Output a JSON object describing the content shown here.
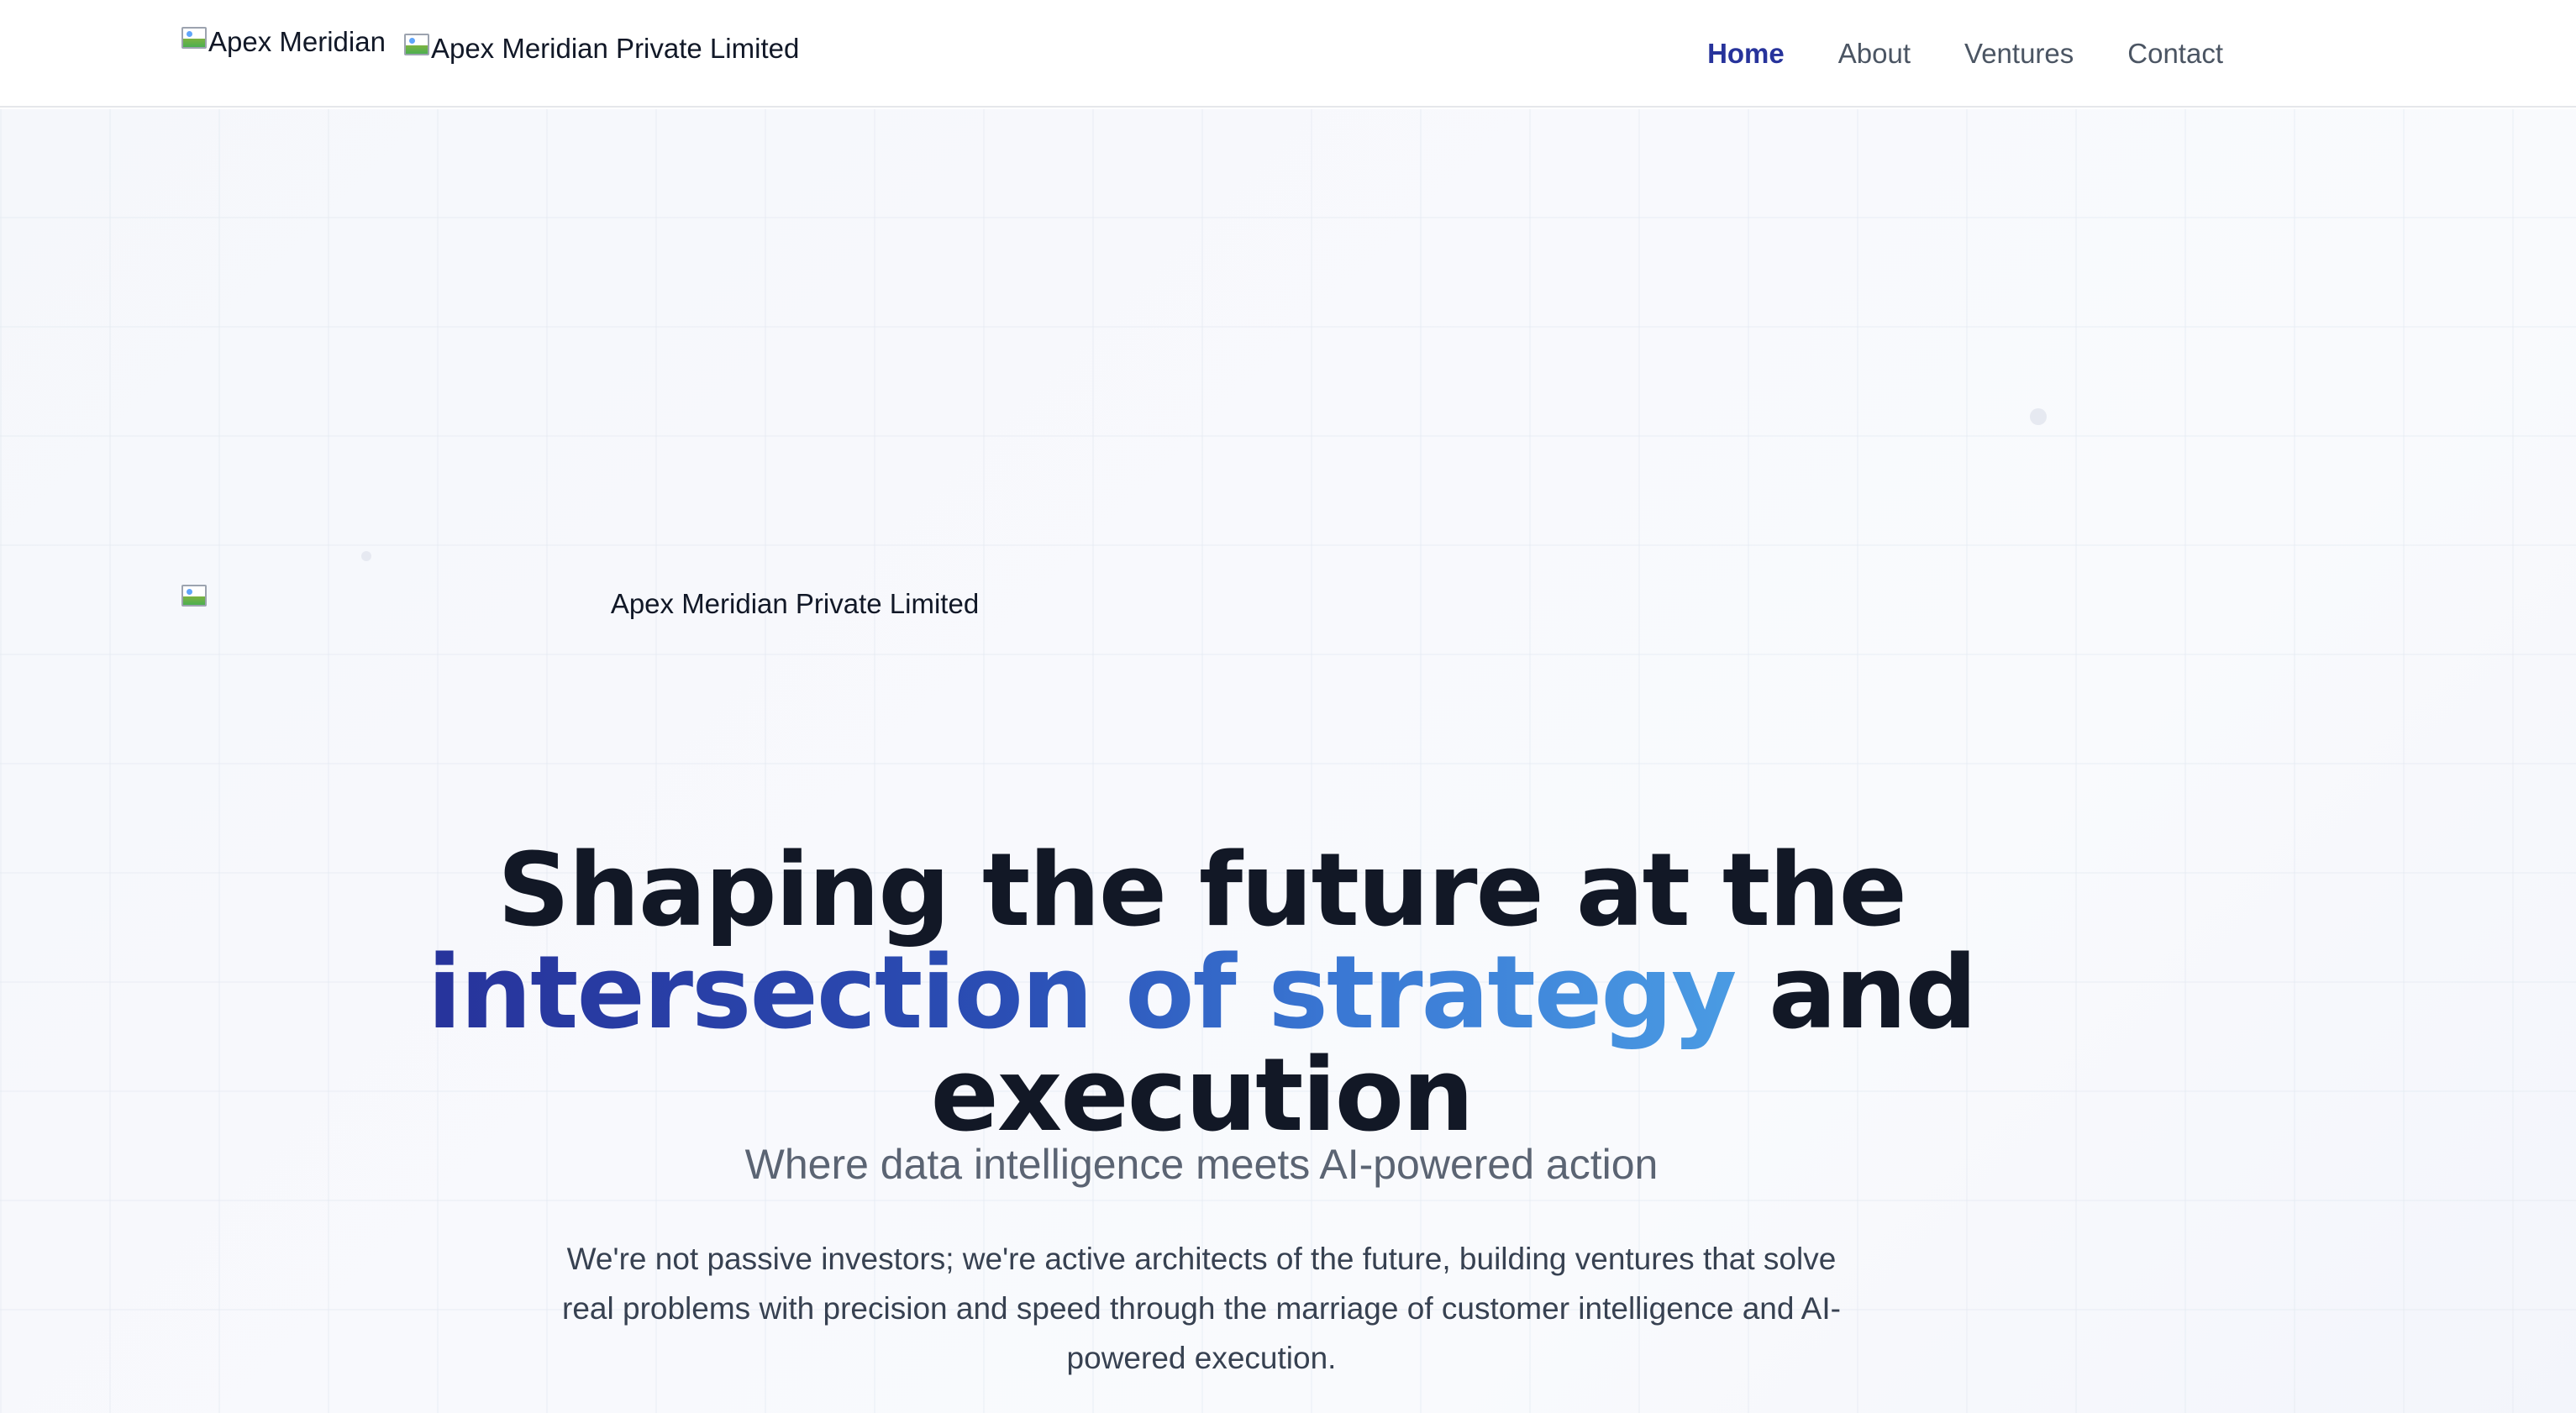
{
  "header": {
    "logo_alt": "Apex Meridian",
    "wordmark_alt": "Apex Meridian Private Limited"
  },
  "nav": {
    "items": [
      {
        "label": "Home",
        "active": true
      },
      {
        "label": "About",
        "active": false
      },
      {
        "label": "Ventures",
        "active": false
      },
      {
        "label": "Contact",
        "active": false
      }
    ]
  },
  "hero": {
    "logo_alt": "Apex Meridian Private Limited",
    "headline": {
      "part1": "Shaping the future at the ",
      "accent": "intersection of strategy",
      "part2": " and execution"
    },
    "subtitle": "Where data intelligence meets AI-powered action",
    "description": "We're not passive investors; we're active architects of the future, building ventures that solve real problems with precision and speed through the marriage of customer intelligence and AI-powered execution."
  },
  "colors": {
    "nav_active": "#27339b",
    "headline": "#121826",
    "accent_start": "#27339b",
    "accent_end": "#4a9be3",
    "subtitle": "#5b6473",
    "body_text": "#374151"
  }
}
